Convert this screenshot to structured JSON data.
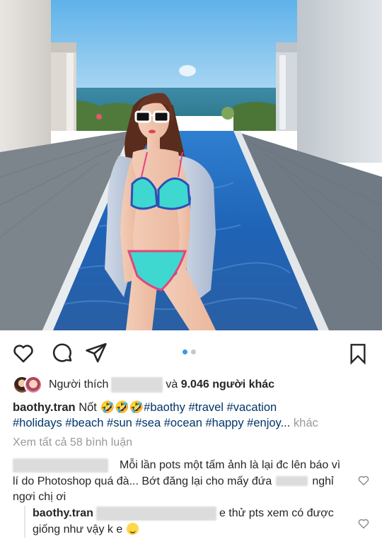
{
  "post": {
    "photo_alt": "",
    "carousel": {
      "count": 2,
      "active": 0
    }
  },
  "actions": {
    "like_icon": "heart-outline-icon",
    "comment_icon": "comment-bubble-icon",
    "share_icon": "paper-plane-icon",
    "save_icon": "bookmark-icon"
  },
  "likes": {
    "prefix": "Người thích",
    "connector": "và",
    "count_text": "9.046 người khác"
  },
  "caption": {
    "username": "baothy.tran",
    "text": "Nốt",
    "emojis": "🤣🤣🤣",
    "hashtags_line1": "#baothy #travel #vacation",
    "hashtags_line2": "#holidays #beach #sun #sea #ocean #happy #enjoy...",
    "more": "khác"
  },
  "view_all": "Xem tất cả 58 bình luận",
  "comments": [
    {
      "text_a": "Mỗi lần pots một tấm ảnh là lại đc lên báo vì lí do Photoshop quá đà... Bớt đăng lại cho mấy đứa",
      "text_b": "nghỉ ngơi chị ơi"
    }
  ],
  "reply": {
    "username": "baothy.tran",
    "text": "e thử pts xem có được giống như vậy k e",
    "emoji": "☺️"
  },
  "colors": {
    "accent_blue": "#3897f0",
    "hashtag": "#003569",
    "muted": "#999999",
    "text": "#262626"
  }
}
